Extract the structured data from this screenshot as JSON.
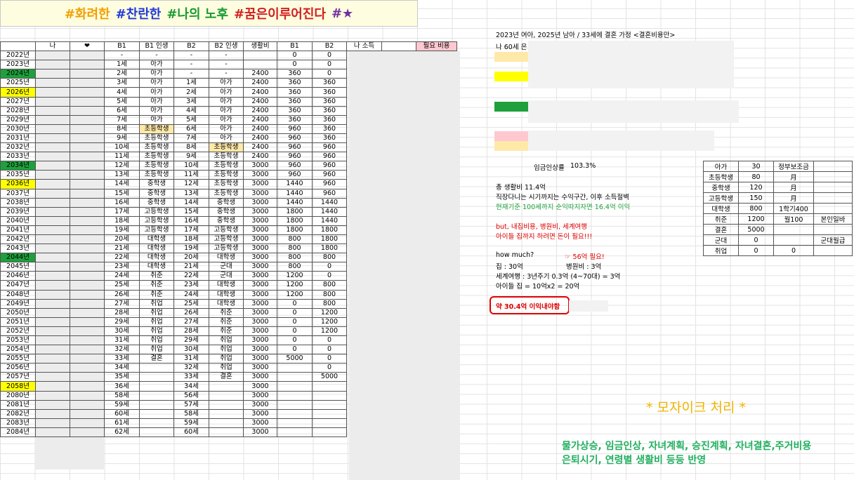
{
  "banner": [
    {
      "text": "#화려한",
      "color": "#f0a000"
    },
    {
      "text": "#찬란한",
      "color": "#2038d8"
    },
    {
      "text": "#나의 노후",
      "color": "#1a9a30"
    },
    {
      "text": "#꿈은이루어진다",
      "color": "#d02020"
    },
    {
      "text": "#★",
      "color": "#7030a0"
    }
  ],
  "headers": [
    "",
    "나",
    "❤",
    "B1",
    "B1 인생",
    "B2",
    "B2 인생",
    "생활비",
    "B1",
    "B2",
    "나 소득",
    "",
    "필요 비용"
  ],
  "highlight_colors": {
    "green": "#1ea03c",
    "yellow": "#ffff00",
    "pink": "#ffc8d0",
    "peach": "#ffe9a8",
    "header_pink": "#ffc8d0"
  },
  "rows": [
    {
      "year": "2022년",
      "b1": "-",
      "b1l": "-",
      "b2": "-",
      "b2l": "-",
      "cost": "",
      "c1": "0",
      "c2": "0",
      "hl": ""
    },
    {
      "year": "2023년",
      "b1": "1세",
      "b1l": "아가",
      "b2": "-",
      "b2l": "-",
      "cost": "",
      "c1": "0",
      "c2": "0",
      "hl": ""
    },
    {
      "year": "2024년",
      "b1": "2세",
      "b1l": "아가",
      "b2": "-",
      "b2l": "-",
      "cost": "2400",
      "c1": "360",
      "c2": "0",
      "hl": "green"
    },
    {
      "year": "2025년",
      "b1": "3세",
      "b1l": "아가",
      "b2": "1세",
      "b2l": "아가",
      "cost": "2400",
      "c1": "360",
      "c2": "360",
      "hl": ""
    },
    {
      "year": "2026년",
      "b1": "4세",
      "b1l": "아가",
      "b2": "2세",
      "b2l": "아가",
      "cost": "2400",
      "c1": "360",
      "c2": "360",
      "hl": "yellow"
    },
    {
      "year": "2027년",
      "b1": "5세",
      "b1l": "아가",
      "b2": "3세",
      "b2l": "아가",
      "cost": "2400",
      "c1": "360",
      "c2": "360",
      "hl": ""
    },
    {
      "year": "2028년",
      "b1": "6세",
      "b1l": "아가",
      "b2": "4세",
      "b2l": "아가",
      "cost": "2400",
      "c1": "360",
      "c2": "360",
      "hl": ""
    },
    {
      "year": "2029년",
      "b1": "7세",
      "b1l": "아가",
      "b2": "5세",
      "b2l": "아가",
      "cost": "2400",
      "c1": "360",
      "c2": "360",
      "hl": ""
    },
    {
      "year": "2030년",
      "b1": "8세",
      "b1l": "초등학생",
      "b2": "6세",
      "b2l": "아가",
      "cost": "2400",
      "c1": "960",
      "c2": "360",
      "hl": "",
      "b1lhl": true
    },
    {
      "year": "2031년",
      "b1": "9세",
      "b1l": "초등학생",
      "b2": "7세",
      "b2l": "아가",
      "cost": "2400",
      "c1": "960",
      "c2": "360",
      "hl": ""
    },
    {
      "year": "2032년",
      "b1": "10세",
      "b1l": "초등학생",
      "b2": "8세",
      "b2l": "초등학생",
      "cost": "2400",
      "c1": "960",
      "c2": "960",
      "hl": "",
      "b2lhl": true
    },
    {
      "year": "2033년",
      "b1": "11세",
      "b1l": "초등학생",
      "b2": "9세",
      "b2l": "초등학생",
      "cost": "2400",
      "c1": "960",
      "c2": "960",
      "hl": ""
    },
    {
      "year": "2034년",
      "b1": "12세",
      "b1l": "초등학생",
      "b2": "10세",
      "b2l": "초등학생",
      "cost": "3000",
      "c1": "960",
      "c2": "960",
      "hl": "green"
    },
    {
      "year": "2035년",
      "b1": "13세",
      "b1l": "초등학생",
      "b2": "11세",
      "b2l": "초등학생",
      "cost": "3000",
      "c1": "960",
      "c2": "960",
      "hl": ""
    },
    {
      "year": "2036년",
      "b1": "14세",
      "b1l": "중학생",
      "b2": "12세",
      "b2l": "초등학생",
      "cost": "3000",
      "c1": "1440",
      "c2": "960",
      "hl": "yellow"
    },
    {
      "year": "2037년",
      "b1": "15세",
      "b1l": "중학생",
      "b2": "13세",
      "b2l": "초등학생",
      "cost": "3000",
      "c1": "1440",
      "c2": "960",
      "hl": ""
    },
    {
      "year": "2038년",
      "b1": "16세",
      "b1l": "중학생",
      "b2": "14세",
      "b2l": "중학생",
      "cost": "3000",
      "c1": "1440",
      "c2": "1440",
      "hl": ""
    },
    {
      "year": "2039년",
      "b1": "17세",
      "b1l": "고등학생",
      "b2": "15세",
      "b2l": "중학생",
      "cost": "3000",
      "c1": "1800",
      "c2": "1440",
      "hl": ""
    },
    {
      "year": "2040년",
      "b1": "18세",
      "b1l": "고등학생",
      "b2": "16세",
      "b2l": "중학생",
      "cost": "3000",
      "c1": "1800",
      "c2": "1440",
      "hl": ""
    },
    {
      "year": "2041년",
      "b1": "19세",
      "b1l": "고등학생",
      "b2": "17세",
      "b2l": "고등학생",
      "cost": "3000",
      "c1": "1800",
      "c2": "1800",
      "hl": ""
    },
    {
      "year": "2042년",
      "b1": "20세",
      "b1l": "대학생",
      "b2": "18세",
      "b2l": "고등학생",
      "cost": "3000",
      "c1": "800",
      "c2": "1800",
      "hl": ""
    },
    {
      "year": "2043년",
      "b1": "21세",
      "b1l": "대학생",
      "b2": "19세",
      "b2l": "고등학생",
      "cost": "3000",
      "c1": "800",
      "c2": "1800",
      "hl": ""
    },
    {
      "year": "2044년",
      "b1": "22세",
      "b1l": "대학생",
      "b2": "20세",
      "b2l": "대학생",
      "cost": "3000",
      "c1": "800",
      "c2": "800",
      "hl": "green"
    },
    {
      "year": "2045년",
      "b1": "23세",
      "b1l": "대학생",
      "b2": "21세",
      "b2l": "군대",
      "cost": "3000",
      "c1": "800",
      "c2": "0",
      "hl": ""
    },
    {
      "year": "2046년",
      "b1": "24세",
      "b1l": "취준",
      "b2": "22세",
      "b2l": "군대",
      "cost": "3000",
      "c1": "1200",
      "c2": "0",
      "hl": ""
    },
    {
      "year": "2047년",
      "b1": "25세",
      "b1l": "취준",
      "b2": "23세",
      "b2l": "대학생",
      "cost": "3000",
      "c1": "1200",
      "c2": "800",
      "hl": ""
    },
    {
      "year": "2048년",
      "b1": "26세",
      "b1l": "취준",
      "b2": "24세",
      "b2l": "대학생",
      "cost": "3000",
      "c1": "1200",
      "c2": "800",
      "hl": ""
    },
    {
      "year": "2049년",
      "b1": "27세",
      "b1l": "취업",
      "b2": "25세",
      "b2l": "대학생",
      "cost": "3000",
      "c1": "0",
      "c2": "800",
      "hl": ""
    },
    {
      "year": "2050년",
      "b1": "28세",
      "b1l": "취업",
      "b2": "26세",
      "b2l": "취준",
      "cost": "3000",
      "c1": "0",
      "c2": "1200",
      "hl": ""
    },
    {
      "year": "2051년",
      "b1": "29세",
      "b1l": "취업",
      "b2": "27세",
      "b2l": "취준",
      "cost": "3000",
      "c1": "0",
      "c2": "1200",
      "hl": ""
    },
    {
      "year": "2052년",
      "b1": "30세",
      "b1l": "취업",
      "b2": "28세",
      "b2l": "취준",
      "cost": "3000",
      "c1": "0",
      "c2": "1200",
      "hl": ""
    },
    {
      "year": "2053년",
      "b1": "31세",
      "b1l": "취업",
      "b2": "29세",
      "b2l": "취업",
      "cost": "3000",
      "c1": "0",
      "c2": "0",
      "hl": ""
    },
    {
      "year": "2054년",
      "b1": "32세",
      "b1l": "취업",
      "b2": "30세",
      "b2l": "취업",
      "cost": "3000",
      "c1": "0",
      "c2": "0",
      "hl": ""
    },
    {
      "year": "2055년",
      "b1": "33세",
      "b1l": "결혼",
      "b2": "31세",
      "b2l": "취업",
      "cost": "3000",
      "c1": "5000",
      "c2": "0",
      "hl": ""
    },
    {
      "year": "2056년",
      "b1": "34세",
      "b1l": "",
      "b2": "32세",
      "b2l": "취업",
      "cost": "3000",
      "c1": "",
      "c2": "0",
      "hl": ""
    },
    {
      "year": "2057년",
      "b1": "35세",
      "b1l": "",
      "b2": "33세",
      "b2l": "결혼",
      "cost": "3000",
      "c1": "",
      "c2": "5000",
      "hl": ""
    },
    {
      "year": "2058년",
      "b1": "36세",
      "b1l": "",
      "b2": "34세",
      "b2l": "",
      "cost": "3000",
      "c1": "",
      "c2": "",
      "hl": "yellow"
    },
    {
      "year": "2080년",
      "b1": "58세",
      "b1l": "",
      "b2": "56세",
      "b2l": "",
      "cost": "3000",
      "c1": "",
      "c2": "",
      "hl": ""
    },
    {
      "year": "2081년",
      "b1": "59세",
      "b1l": "",
      "b2": "57세",
      "b2l": "",
      "cost": "3000",
      "c1": "",
      "c2": "",
      "hl": ""
    },
    {
      "year": "2082년",
      "b1": "60세",
      "b1l": "",
      "b2": "58세",
      "b2l": "",
      "cost": "3000",
      "c1": "",
      "c2": "",
      "hl": ""
    },
    {
      "year": "2083년",
      "b1": "61세",
      "b1l": "",
      "b2": "59세",
      "b2l": "",
      "cost": "3000",
      "c1": "",
      "c2": "",
      "hl": ""
    },
    {
      "year": "2084년",
      "b1": "62세",
      "b1l": "",
      "b2": "60세",
      "b2l": "",
      "cost": "3000",
      "c1": "",
      "c2": "",
      "hl": ""
    }
  ],
  "right_panel": {
    "heading": "2023년 여아, 2025년 남아 / 33세에 결혼 가정 <결혼비용만>",
    "line_me": "나 60세 은",
    "wage_label": "임금인상률",
    "wage_value": "103.3%",
    "summary_1": "총 생활비 11.4억",
    "summary_2": "직장다니는 시기까지는 수익구간, 이후 소득절벽",
    "summary_3": "현재기준 100세까지 순익따지자면 16.4억 이익",
    "warn_1": "but, 내집비용, 병원비, 세계여행",
    "warn_2": "아이들 집까지 하려면 돈이 필요!!!",
    "how_much": "how much?",
    "need": "☞ 56억 필요!",
    "house": "집 : 30억",
    "hospital": "병원비 : 3억",
    "travel": "세계여행 : 3년주기 0.3억 (4~70대) = 3억",
    "kids_house": "아이들 집 = 10억x2 = 20억",
    "result": "약 30.4억 이익내야함"
  },
  "side_table": [
    [
      "아가",
      "30",
      "정부보조금",
      ""
    ],
    [
      "초등학생",
      "80",
      "月",
      ""
    ],
    [
      "중학생",
      "120",
      "月",
      ""
    ],
    [
      "고등학생",
      "150",
      "月",
      ""
    ],
    [
      "대학생",
      "800",
      "1학기400",
      ""
    ],
    [
      "취준",
      "1200",
      "월100",
      "본인일바"
    ],
    [
      "결혼",
      "5000",
      "",
      ""
    ],
    [
      "군대",
      "0",
      "",
      "군대월급"
    ],
    [
      "취업",
      "0",
      "0",
      ""
    ]
  ],
  "mosaic_note": "* 모자이크 처리 *",
  "bottom_note_1": "물가상승, 임금인상, 자녀계획, 승진계획, 자녀결혼,주거비용",
  "bottom_note_2": "은퇴시기, 연령별 생활비 등등 반영"
}
